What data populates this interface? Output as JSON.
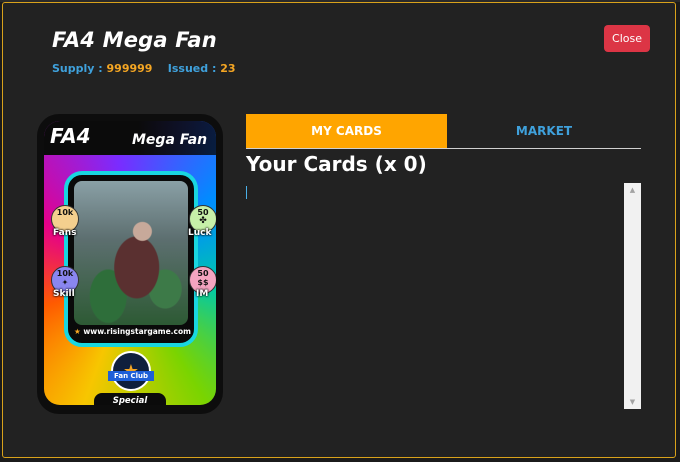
{
  "modal": {
    "title": "FA4 Mega Fan",
    "supply_label": "Supply :",
    "supply_value": "999999",
    "issued_label": "Issued :",
    "issued_value": "23",
    "close_label": "Close"
  },
  "card": {
    "code": "FA4",
    "name": "Mega Fan",
    "stats": [
      {
        "value": "10k",
        "label": "Fans",
        "color": "#f4cf8e"
      },
      {
        "value": "50",
        "label": "Luck",
        "color": "#c7f0a8"
      },
      {
        "value": "10k",
        "label": "Skill",
        "color": "#8a86f0"
      },
      {
        "value": "50",
        "label": "IM",
        "color": "#f4a4c0"
      }
    ],
    "url": "www.risingstargame.com",
    "badge": "Fan Club",
    "rarity": "Special"
  },
  "tabs": [
    {
      "label": "MY CARDS",
      "active": true
    },
    {
      "label": "MARKET",
      "active": false
    }
  ],
  "cards_heading": "Your Cards (x 0)",
  "colors": {
    "accent_orange": "#ffa500",
    "link_blue": "#3fa1dc",
    "close_red": "#dc3545",
    "modal_border": "#d9a21b"
  }
}
